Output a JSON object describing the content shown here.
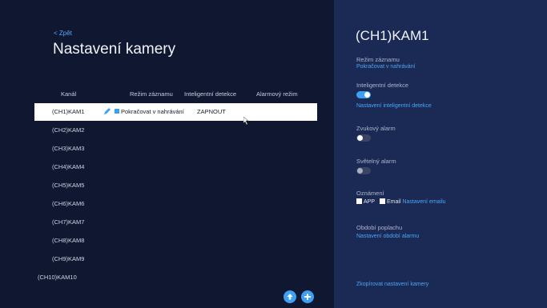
{
  "nav": {
    "back_label": "< Zpět"
  },
  "page": {
    "title": "Nastavení kamery"
  },
  "table": {
    "headers": [
      "Kanál",
      "Režim záznamu",
      "Inteligentní detekce",
      "Alarmový režim"
    ],
    "rows": [
      {
        "channel": "(CH1)KAM1",
        "mode": "Pokračovat v nahrávání",
        "detection": "ZAPNOUT",
        "selected": true
      },
      {
        "channel": "(CH2)KAM2"
      },
      {
        "channel": "(CH3)KAM3"
      },
      {
        "channel": "(CH4)KAM4"
      },
      {
        "channel": "(CH5)KAM5"
      },
      {
        "channel": "(CH6)KAM6"
      },
      {
        "channel": "(CH7)KAM7"
      },
      {
        "channel": "(CH8)KAM8"
      },
      {
        "channel": "(CH9)KAM9"
      },
      {
        "channel": "(CH10)KAM10"
      }
    ]
  },
  "fabs": {
    "upload_icon": "upload-icon",
    "add_icon": "plus-icon"
  },
  "panel": {
    "title": "(CH1)KAM1",
    "record_mode_label": "Režim záznamu",
    "record_mode_value": "Pokračovat v nahrávání",
    "smart_detect_label": "Inteligentní detekce",
    "smart_detect_on": true,
    "smart_detect_link": "Nastavení inteligentní detekce",
    "sound_alarm_label": "Zvukový alarm",
    "sound_alarm_on": false,
    "light_alarm_label": "Světelný alarm",
    "light_alarm_on": false,
    "notify_label": "Oznámení",
    "app_label": "APP",
    "email_label": "Email",
    "email_link": "Nastavení emailu",
    "alarm_period_label": "Období poplachu",
    "alarm_period_link": "Nastavení období alarmu",
    "copy_link": "Zkopírovat nastavení kamery"
  },
  "colors": {
    "accent": "#3da0f2",
    "main_bg": "#0f1731",
    "panel_bg": "#1b2955"
  }
}
